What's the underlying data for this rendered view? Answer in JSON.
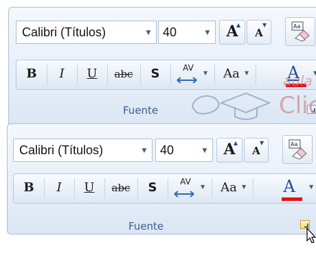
{
  "top_panel": {
    "font_name": "Calibri (Títulos)",
    "font_size": "40",
    "group_label": "Fuente"
  },
  "bottom_panel": {
    "font_name": "Calibri (Títulos)",
    "font_size": "40",
    "group_label": "Fuente"
  },
  "buttons": {
    "grow": "A",
    "shrink": "A",
    "bold": "B",
    "italic": "I",
    "underline": "U",
    "strike": "abc",
    "shadow": "S",
    "spacing": "AV",
    "case": "Aa",
    "color": "A"
  },
  "watermark": {
    "line1": "aula",
    "line2": "Clic"
  },
  "colors": {
    "font_color_bar": "#e0101a",
    "group_label": "#3b5d8f",
    "launcher_hover": "#fcd970"
  },
  "icons": [
    "chevron-down-icon",
    "grow-font-icon",
    "shrink-font-icon",
    "clear-formatting-icon",
    "dialog-launcher-icon",
    "mouse-cursor-icon"
  ]
}
